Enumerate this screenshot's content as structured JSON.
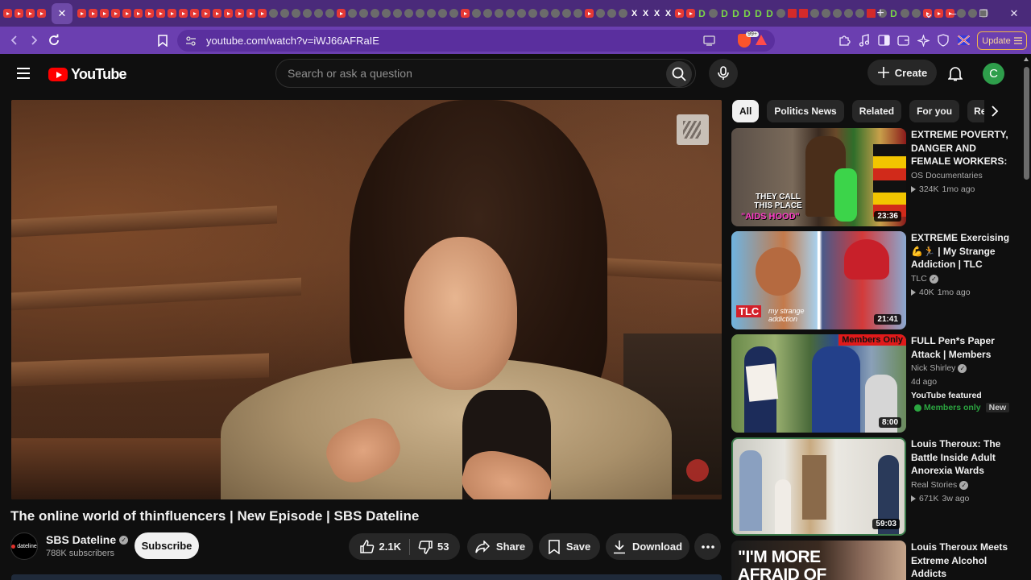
{
  "browser": {
    "new_tab_label": "+",
    "url": "youtube.com/watch?v=iWJ66AFRaIE",
    "update_label": "Update",
    "brave_badge": "99+",
    "window_minimize": "─",
    "window_restore": "❐",
    "window_close": "✕",
    "tab_list_label": "⌄"
  },
  "youtube": {
    "logo_text": "YouTube",
    "search_placeholder": "Search or ask a question",
    "create_label": "Create",
    "avatar_letter": "C"
  },
  "video": {
    "title": "The online world of thinfluencers | New Episode | SBS Dateline",
    "channel_name": "SBS Dateline",
    "channel_avatar_text": "dateline",
    "subscribers": "788K subscribers",
    "subscribe_label": "Subscribe",
    "likes": "2.1K",
    "dislikes": "53",
    "share_label": "Share",
    "save_label": "Save",
    "download_label": "Download"
  },
  "chips": [
    "All",
    "Politics News",
    "Related",
    "For you",
    "Recently uploaded"
  ],
  "recommendations": [
    {
      "title": "EXTREME POVERTY, DANGER AND FEMALE WORKERS: UGANDA'...",
      "channel": "OS Documentaries",
      "verified": false,
      "views": "324K",
      "age": "1mo ago",
      "duration": "23:36",
      "thumb_overlay": "THEY CALL THIS PLACE",
      "thumb_overlay2": "\"AIDS HOOD\""
    },
    {
      "title": "EXTREME Exercising 💪🏃 | My Strange Addiction | TLC",
      "channel": "TLC",
      "verified": true,
      "views": "40K",
      "age": "1mo ago",
      "duration": "21:41",
      "thumb_overlay": "TLC",
      "thumb_overlay2": "my strange addiction"
    },
    {
      "title": "FULL Pen*s Paper Attack | Members Only",
      "channel": "Nick Shirley",
      "verified": true,
      "age": "4d ago",
      "featured": "YouTube featured",
      "members_badge": "Members only",
      "new_badge": "New",
      "duration": "8:00",
      "thumb_overlay": "Members Only"
    },
    {
      "title": "Louis Theroux: The Battle Inside Adult Anorexia Wards",
      "channel": "Real Stories",
      "verified": true,
      "views": "671K",
      "age": "3w ago",
      "duration": "59:03"
    },
    {
      "title": "Louis Theroux Meets Extreme Alcohol Addicts",
      "thumb_overlay": "\"I'M MORE AFRAID OF"
    }
  ],
  "colors": {
    "tab_strip": "#4a2a7a",
    "toolbar": "#6b3fb0",
    "youtube_red": "#ff0000",
    "background": "#0f0f0f",
    "members_green": "#2ba640"
  }
}
